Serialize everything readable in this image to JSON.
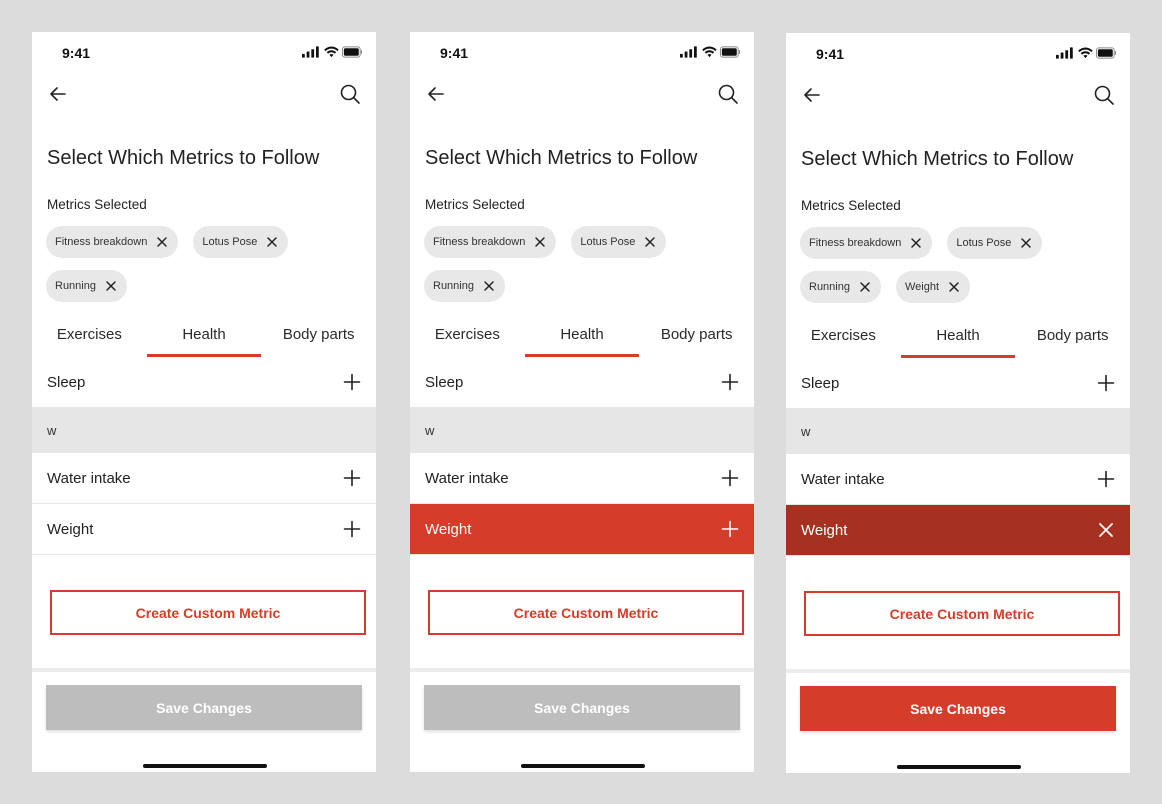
{
  "colors": {
    "accent": "#d53d2a",
    "accent_dark": "#a63121",
    "disabled": "#bdbdbd",
    "chip_bg": "#e8e8e8"
  },
  "icons": {
    "back": "arrow-left-icon",
    "search": "search-icon",
    "add": "plus-icon",
    "remove": "close-icon",
    "signal": "cellular-signal-icon",
    "wifi": "wifi-icon",
    "battery": "battery-icon"
  },
  "screens": [
    {
      "status_time": "9:41",
      "title": "Select Which Metrics to Follow",
      "selected_label": "Metrics Selected",
      "chips": [
        "Fitness breakdown",
        "Lotus Pose",
        "Running"
      ],
      "tabs": [
        {
          "label": "Exercises",
          "active": false
        },
        {
          "label": "Health",
          "active": true
        },
        {
          "label": "Body parts",
          "active": false
        }
      ],
      "rows": [
        {
          "label": "Sleep",
          "state": "default",
          "action": "add"
        },
        {
          "label": "w",
          "state": "query",
          "action": "none"
        },
        {
          "label": "Water intake",
          "state": "default",
          "action": "add"
        },
        {
          "label": "Weight",
          "state": "default",
          "action": "add"
        }
      ],
      "custom_button": "Create Custom Metric",
      "save_button": "Save Changes",
      "save_enabled": false
    },
    {
      "status_time": "9:41",
      "title": "Select Which Metrics to Follow",
      "selected_label": "Metrics Selected",
      "chips": [
        "Fitness breakdown",
        "Lotus Pose",
        "Running"
      ],
      "tabs": [
        {
          "label": "Exercises",
          "active": false
        },
        {
          "label": "Health",
          "active": true
        },
        {
          "label": "Body parts",
          "active": false
        }
      ],
      "rows": [
        {
          "label": "Sleep",
          "state": "default",
          "action": "add"
        },
        {
          "label": "w",
          "state": "query",
          "action": "none"
        },
        {
          "label": "Water intake",
          "state": "default",
          "action": "add"
        },
        {
          "label": "Weight",
          "state": "highlighted",
          "action": "add"
        }
      ],
      "custom_button": "Create Custom Metric",
      "save_button": "Save Changes",
      "save_enabled": false
    },
    {
      "status_time": "9:41",
      "title": "Select Which Metrics to Follow",
      "selected_label": "Metrics Selected",
      "chips": [
        "Fitness breakdown",
        "Lotus Pose",
        "Running",
        "Weight"
      ],
      "tabs": [
        {
          "label": "Exercises",
          "active": false
        },
        {
          "label": "Health",
          "active": true
        },
        {
          "label": "Body parts",
          "active": false
        }
      ],
      "rows": [
        {
          "label": "Sleep",
          "state": "default",
          "action": "add"
        },
        {
          "label": "w",
          "state": "query",
          "action": "none"
        },
        {
          "label": "Water intake",
          "state": "default",
          "action": "add"
        },
        {
          "label": "Weight",
          "state": "selected",
          "action": "remove"
        }
      ],
      "custom_button": "Create Custom Metric",
      "save_button": "Save Changes",
      "save_enabled": true
    }
  ]
}
